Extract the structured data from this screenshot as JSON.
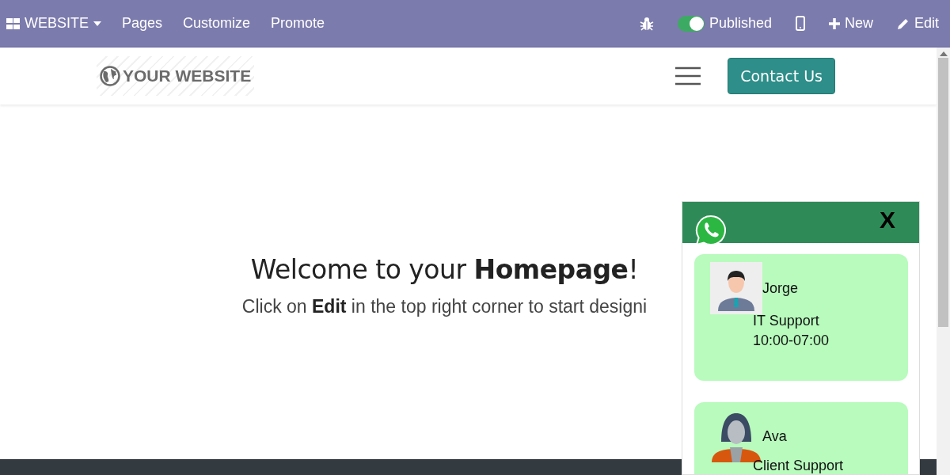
{
  "admin_bar": {
    "app_menu": "WEBSITE",
    "menus": [
      "Pages",
      "Customize",
      "Promote"
    ],
    "published": {
      "label": "Published",
      "on": true
    },
    "new_label": "New",
    "edit_label": "Edit"
  },
  "header": {
    "logo_text": "YOUR WEBSITE",
    "contact_button": "Contact Us"
  },
  "hero": {
    "title": "Welcome to your **Homepage**!",
    "subtitle": "Click on **Edit** in the top right corner to start designi"
  },
  "chat": {
    "close": "X",
    "agents": [
      {
        "kind": "man",
        "name": "Jorge",
        "role": "IT Support",
        "hours": "10:00-07:00"
      },
      {
        "kind": "woman",
        "name": "Ava",
        "role": "Client Support"
      }
    ]
  }
}
